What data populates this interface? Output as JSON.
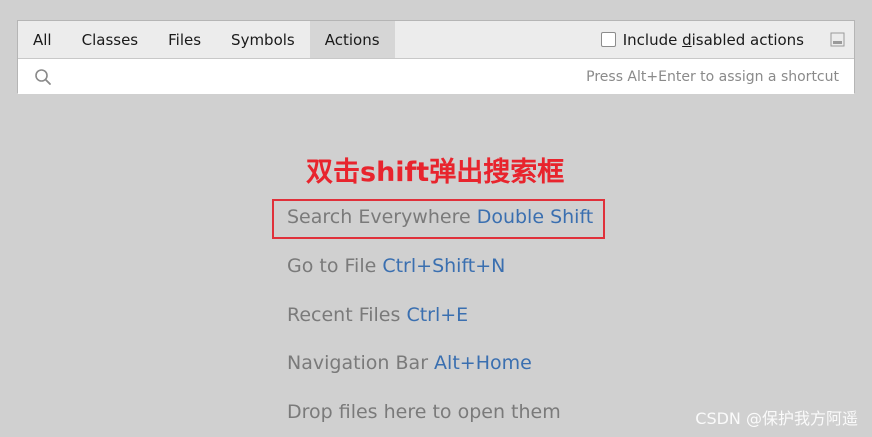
{
  "tabs": [
    "All",
    "Classes",
    "Files",
    "Symbols",
    "Actions"
  ],
  "selected_tab": "Actions",
  "include_disabled": {
    "prefix": "Include ",
    "mnemonic": "d",
    "suffix": "isabled actions",
    "checked": false
  },
  "search": {
    "value": "",
    "hint": "Press Alt+Enter to assign a shortcut"
  },
  "annotation_text": "双击shift弹出搜索框",
  "hints": [
    {
      "label": "Search Everywhere ",
      "shortcut": "Double Shift"
    },
    {
      "label": "Go to File ",
      "shortcut": "Ctrl+Shift+N"
    },
    {
      "label": "Recent Files ",
      "shortcut": "Ctrl+E"
    },
    {
      "label": "Navigation Bar ",
      "shortcut": "Alt+Home"
    },
    {
      "label": "Drop files here to open them",
      "shortcut": ""
    }
  ],
  "watermark": "CSDN @保护我方阿遥",
  "colors": {
    "background": "#d0d0d0",
    "shortcut_text": "#3a6fb0",
    "annotation": "#e8242d",
    "highlight_border": "#e0303a"
  },
  "icons": {
    "search": "search-icon",
    "dock": "dock-window-icon"
  }
}
